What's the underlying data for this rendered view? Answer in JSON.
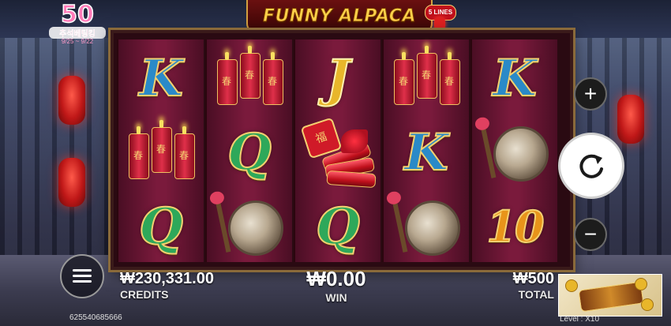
{
  "promo": {
    "number": "50",
    "text": "추석베팅킹",
    "dates": "9/25 ~ 9/22"
  },
  "title": {
    "text": "FUNNY ALPACA",
    "lines_badge": "5 LINES"
  },
  "reels": [
    [
      "K",
      "firecrackers",
      "Q"
    ],
    [
      "firecrackers",
      "Q",
      "gong"
    ],
    [
      "J",
      "firecracker-bundle",
      "Q"
    ],
    [
      "firecrackers",
      "K",
      "gong"
    ],
    [
      "K",
      "gong",
      "10"
    ]
  ],
  "cracker_glyph": "春",
  "bundle_glyph": "福",
  "controls": {
    "plus": "+",
    "minus": "−"
  },
  "stats": {
    "credits_value": "₩230,331.00",
    "credits_label": "CREDITS",
    "win_value": "₩0.00",
    "win_label": "WIN",
    "total_value": "₩500",
    "total_label": "TOTAL"
  },
  "footer": {
    "ticket_id": "625540685666",
    "level": "Level : X10"
  },
  "colors": {
    "frame_gold": "#8a6a3a",
    "reel_red": "#7a1a3c",
    "title_gold": "#ffd24a"
  }
}
